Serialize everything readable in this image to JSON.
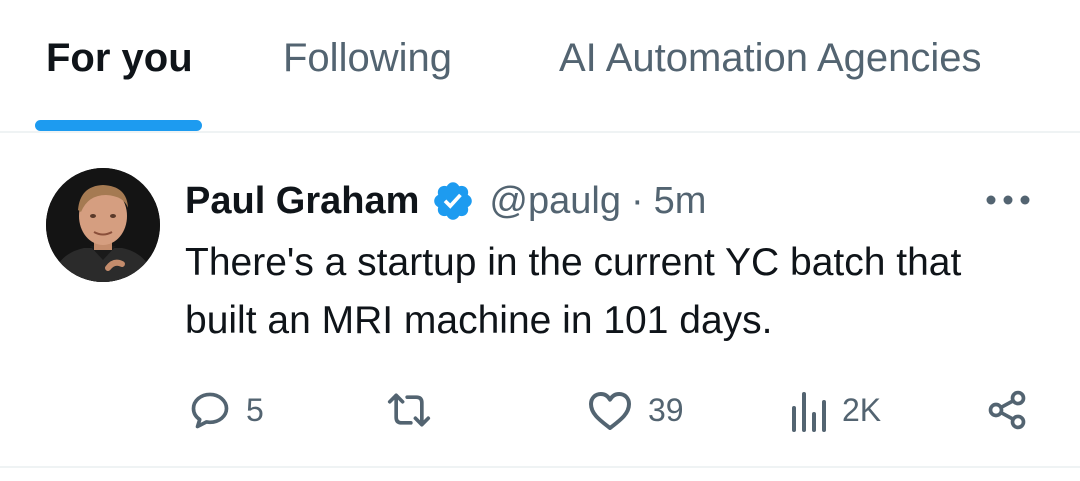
{
  "tabs": [
    {
      "label": "For you",
      "active": true
    },
    {
      "label": "Following",
      "active": false
    },
    {
      "label": "AI Automation Agencies",
      "active": false
    }
  ],
  "post": {
    "author_name": "Paul Graham",
    "verified": true,
    "handle": "@paulg",
    "separator": "·",
    "time": "5m",
    "text": "There's a startup in the current YC batch that built an MRI machine in 101 days.",
    "actions": {
      "replies": "5",
      "reposts": "",
      "likes": "39",
      "views": "2K"
    }
  },
  "colors": {
    "accent": "#1d9bf0",
    "text_primary": "#0f1419",
    "text_secondary": "#536471",
    "divider": "#eff3f4"
  },
  "icons": [
    "verified-badge-icon",
    "more-icon",
    "reply-icon",
    "repost-icon",
    "like-icon",
    "views-icon",
    "share-icon"
  ]
}
